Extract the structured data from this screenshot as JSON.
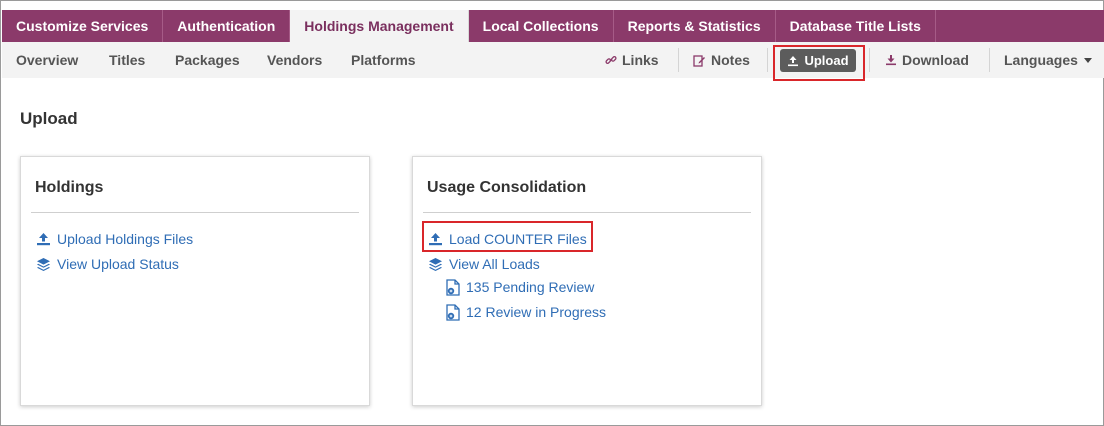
{
  "top_tabs": [
    {
      "label": "Customize Services"
    },
    {
      "label": "Authentication"
    },
    {
      "label": "Holdings Management",
      "active": true
    },
    {
      "label": "Local Collections"
    },
    {
      "label": "Reports & Statistics"
    },
    {
      "label": "Database Title Lists"
    }
  ],
  "sub_nav": {
    "overview": "Overview",
    "titles": "Titles",
    "packages": "Packages",
    "vendors": "Vendors",
    "platforms": "Platforms",
    "links": "Links",
    "notes": "Notes",
    "upload": "Upload",
    "download": "Download",
    "languages": "Languages"
  },
  "page": {
    "title": "Upload"
  },
  "holdings_panel": {
    "title": "Holdings",
    "upload_files": "Upload Holdings Files",
    "view_status": "View Upload Status"
  },
  "usage_panel": {
    "title": "Usage Consolidation",
    "load_counter": "Load COUNTER Files",
    "view_loads": "View All Loads",
    "pending_review": "135 Pending Review",
    "review_in_progress": "12 Review in Progress"
  },
  "colors": {
    "brand": "#8b3a6a",
    "link": "#2f6db5",
    "highlight": "#d9262a",
    "upload_button": "#5c5c5c"
  },
  "icons": {
    "links": "link-icon",
    "notes": "edit-icon",
    "upload": "upload-icon",
    "download": "download-icon",
    "layers": "layers-icon",
    "document": "document-icon"
  }
}
